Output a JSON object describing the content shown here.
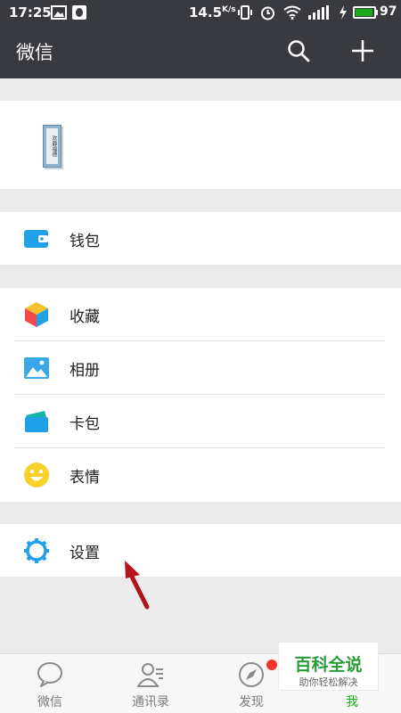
{
  "status_bar": {
    "time": "17:25",
    "network_speed": "14.5",
    "network_speed_unit": "K/s",
    "battery_level": 97,
    "battery_text": "97"
  },
  "header": {
    "title": "微信",
    "search_icon": "search-icon",
    "add_icon": "plus-icon"
  },
  "profile": {
    "avatar_text": "欢静福德"
  },
  "menu": {
    "wallet": {
      "label": "钱包",
      "icon": "wallet-icon"
    },
    "favorites": {
      "label": "收藏",
      "icon": "cube-icon"
    },
    "album": {
      "label": "相册",
      "icon": "image-icon"
    },
    "cards": {
      "label": "卡包",
      "icon": "card-icon"
    },
    "stickers": {
      "label": "表情",
      "icon": "smile-icon"
    },
    "settings": {
      "label": "设置",
      "icon": "gear-icon"
    }
  },
  "tabs": [
    {
      "label": "微信",
      "icon": "chat-icon"
    },
    {
      "label": "通讯录",
      "icon": "contacts-icon"
    },
    {
      "label": "发现",
      "icon": "compass-icon"
    },
    {
      "label": "我",
      "icon": "me-icon"
    }
  ],
  "watermark": {
    "title": "百科全说",
    "subtitle": "助你轻松解决"
  },
  "colors": {
    "header_bg": "#393a3f",
    "accent_green": "#1aad19",
    "badge_red": "#f43530",
    "icon_blue": "#20a0e8"
  }
}
